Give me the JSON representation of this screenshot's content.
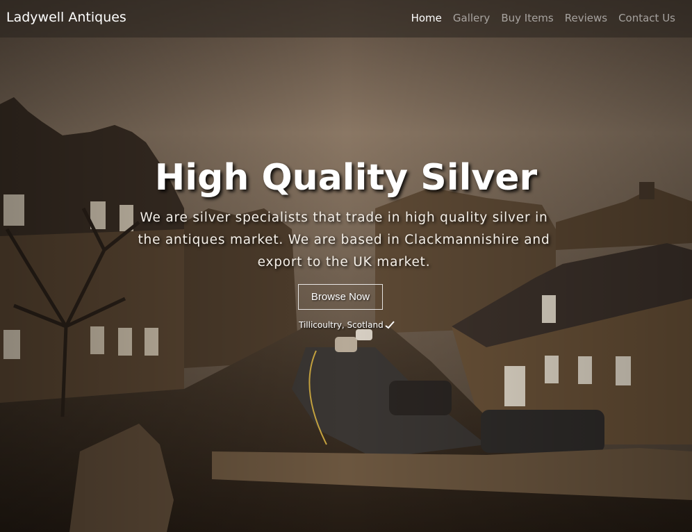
{
  "brand": {
    "name": "Ladywell Antiques"
  },
  "nav": {
    "items": [
      {
        "label": "Home",
        "active": true
      },
      {
        "label": "Gallery",
        "active": false
      },
      {
        "label": "Buy Items",
        "active": false
      },
      {
        "label": "Reviews",
        "active": false
      },
      {
        "label": "Contact Us",
        "active": false
      }
    ]
  },
  "hero": {
    "title": "High Quality Silver",
    "description": "We are silver specialists that trade in high quality silver in the antiques market. We are based in Clackmannishire and export to the UK market.",
    "button_label": "Browse Now",
    "photo_caption": "Tillicoultry, Scotland"
  },
  "colors": {
    "nav_bg": "#28221e",
    "text": "#ffffff",
    "nav_inactive": "#b9b3ad"
  }
}
